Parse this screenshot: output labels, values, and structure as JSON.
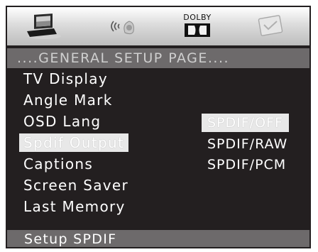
{
  "icon_bar": {
    "icons": [
      "general-setup-icon",
      "audio-speaker-icon",
      "dolby-icon",
      "preference-icon"
    ],
    "dolby_label": "DOLBY"
  },
  "title": "....GENERAL SETUP PAGE....",
  "menu": {
    "items": [
      {
        "label": "TV Display"
      },
      {
        "label": "Angle Mark"
      },
      {
        "label": "OSD Lang"
      },
      {
        "label": "Spdif Output",
        "selected": true
      },
      {
        "label": "Captions"
      },
      {
        "label": "Screen Saver"
      },
      {
        "label": "Last Memory"
      }
    ]
  },
  "options": {
    "items": [
      {
        "label": "SPDIF/OFF",
        "selected": true
      },
      {
        "label": "SPDIF/RAW"
      },
      {
        "label": "SPDIF/PCM"
      }
    ]
  },
  "status": "Setup SPDIF",
  "colors": {
    "screen_background": "#231f20",
    "bar_gray": "#6d6a6b",
    "highlight": "#e8e8e8",
    "text": "#ffffff"
  }
}
